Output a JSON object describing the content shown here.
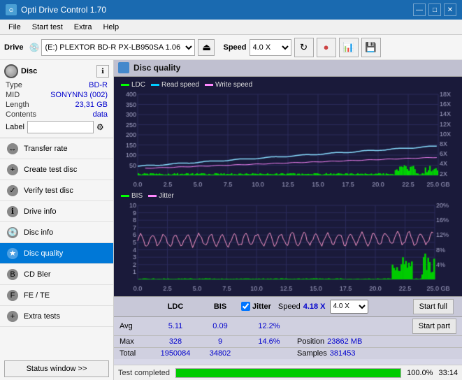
{
  "titleBar": {
    "title": "Opti Drive Control 1.70",
    "minBtn": "—",
    "maxBtn": "□",
    "closeBtn": "✕"
  },
  "menuBar": {
    "items": [
      "File",
      "Start test",
      "Extra",
      "Help"
    ]
  },
  "toolbar": {
    "driveLabel": "Drive",
    "driveValue": "(E:)  PLEXTOR BD-R  PX-LB950SA 1.06",
    "speedLabel": "Speed",
    "speedValue": "4.0 X"
  },
  "disc": {
    "typeLabel": "Type",
    "typeValue": "BD-R",
    "midLabel": "MID",
    "midValue": "SONYNN3 (002)",
    "lengthLabel": "Length",
    "lengthValue": "23,31 GB",
    "contentsLabel": "Contents",
    "contentsValue": "data",
    "labelLabel": "Label"
  },
  "navItems": [
    {
      "id": "transfer-rate",
      "label": "Transfer rate",
      "active": false
    },
    {
      "id": "create-test-disc",
      "label": "Create test disc",
      "active": false
    },
    {
      "id": "verify-test-disc",
      "label": "Verify test disc",
      "active": false
    },
    {
      "id": "drive-info",
      "label": "Drive info",
      "active": false
    },
    {
      "id": "disc-info",
      "label": "Disc info",
      "active": false
    },
    {
      "id": "disc-quality",
      "label": "Disc quality",
      "active": true
    },
    {
      "id": "cd-bler",
      "label": "CD Bler",
      "active": false
    },
    {
      "id": "fe-te",
      "label": "FE / TE",
      "active": false
    },
    {
      "id": "extra-tests",
      "label": "Extra tests",
      "active": false
    }
  ],
  "statusWindow": "Status window >>",
  "chartTitle": "Disc quality",
  "topChart": {
    "legend": [
      {
        "label": "LDC",
        "color": "#00ff00"
      },
      {
        "label": "Read speed",
        "color": "#00ccff"
      },
      {
        "label": "Write speed",
        "color": "#ff88ff"
      }
    ],
    "yAxisLeft": [
      "400",
      "350",
      "300",
      "250",
      "200",
      "150",
      "100",
      "50"
    ],
    "yAxisRight": [
      "18X",
      "16X",
      "14X",
      "12X",
      "10X",
      "8X",
      "6X",
      "4X",
      "2X"
    ],
    "xAxis": [
      "0.0",
      "2.5",
      "5.0",
      "7.5",
      "10.0",
      "12.5",
      "15.0",
      "17.5",
      "20.0",
      "22.5",
      "25.0 GB"
    ]
  },
  "bottomChart": {
    "legend": [
      {
        "label": "BIS",
        "color": "#00ff00"
      },
      {
        "label": "Jitter",
        "color": "#ff88ff"
      }
    ],
    "yAxisLeft": [
      "10",
      "9",
      "8",
      "7",
      "6",
      "5",
      "4",
      "3",
      "2",
      "1"
    ],
    "yAxisRight": [
      "20%",
      "16%",
      "12%",
      "8%",
      "4%"
    ],
    "xAxis": [
      "0.0",
      "2.5",
      "5.0",
      "7.5",
      "10.0",
      "12.5",
      "15.0",
      "17.5",
      "20.0",
      "22.5",
      "25.0 GB"
    ]
  },
  "stats": {
    "columns": {
      "ldc": "LDC",
      "bis": "BIS",
      "jitter": "Jitter",
      "speed": "Speed",
      "speedValue": "4.18 X",
      "speedSelect": "4.0 X"
    },
    "rows": {
      "avg": {
        "label": "Avg",
        "ldc": "5.11",
        "bis": "0.09",
        "jitter": "12.2%"
      },
      "max": {
        "label": "Max",
        "ldc": "328",
        "bis": "9",
        "jitter": "14.6%",
        "positionLabel": "Position",
        "positionValue": "23862 MB"
      },
      "total": {
        "label": "Total",
        "ldc": "1950084",
        "bis": "34802",
        "samplesLabel": "Samples",
        "samplesValue": "381453"
      }
    },
    "startFull": "Start full",
    "startPart": "Start part"
  },
  "progressBar": {
    "value": 100,
    "text": "100.0%",
    "time": "33:14"
  },
  "statusText": "Test completed"
}
